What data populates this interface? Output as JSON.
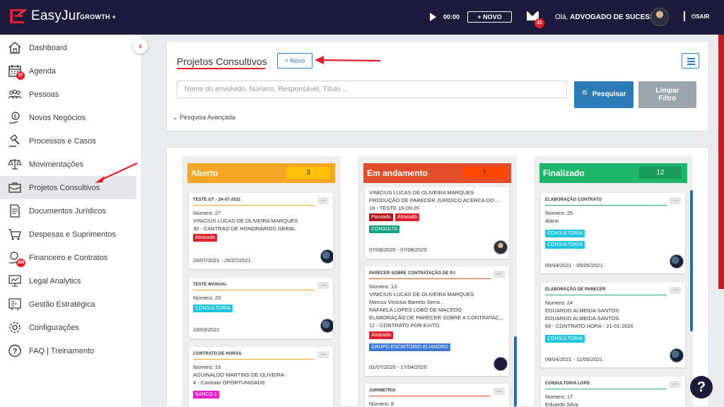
{
  "header": {
    "brand": "EasyJur",
    "plan": "GROWTH +",
    "timer": "00:00",
    "novo_label": "+ NOVO",
    "mail_count": "31",
    "greeting": "Olá,",
    "user": "ADVOGADO DE SUCESSO",
    "logout": "SAIR"
  },
  "sidebar": {
    "items": [
      {
        "label": "Dashboard"
      },
      {
        "label": "Agenda",
        "badge": "37"
      },
      {
        "label": "Pessoas"
      },
      {
        "label": "Novos Negócios"
      },
      {
        "label": "Processos e Casos"
      },
      {
        "label": "Movimentações"
      },
      {
        "label": "Projetos Consultivos"
      },
      {
        "label": "Documentos Jurídicos"
      },
      {
        "label": "Despesas e Suprimentos"
      },
      {
        "label": "Financeiro e Contratos",
        "badge": "290"
      },
      {
        "label": "Legal Analytics"
      },
      {
        "label": "Gestão Estratégica"
      },
      {
        "label": "Configurações"
      },
      {
        "label": "FAQ | Treinamento"
      }
    ]
  },
  "page": {
    "title": "Projetos Consultivos",
    "novo": "+ Novo",
    "search_placeholder": "Nome do envolvido, Número, Responsável, Título...",
    "search_btn": "Pesquisar",
    "clear_btn_1": "Limpar",
    "clear_btn_2": "Filtro",
    "advanced": "Pesquisa Avançada"
  },
  "columns": [
    {
      "title": "Aberto",
      "count": "3",
      "color": "#f5a623",
      "count_bg": "#ffc107",
      "cards": [
        {
          "title": "TESTE GT - 24-07-2021",
          "lines": [
            "Número: 27",
            "VINICIUS LUCAS DE OLIVEIRA MARQUES",
            "30 - CANTRAO DE HONORÁRIOS GERAL"
          ],
          "tags": [
            "Atrasado"
          ],
          "date": "24/07/2021 - 26/07/2021"
        },
        {
          "title": "TESTE MANUAL",
          "lines": [
            "Número: 23"
          ],
          "tags": [
            "CONSULTORIA"
          ],
          "date": "23/03/2021"
        },
        {
          "title": "CONTRATO DE HORAS",
          "lines": [
            "Número: 19",
            "AGUINALDO MARTINS DE OLIVEIRA",
            "4 - Contrato OPORTUNIDADE"
          ],
          "tags": [
            "BANCO 1"
          ]
        }
      ]
    },
    {
      "title": "Em andamento",
      "count": "7",
      "color": "#e04e2b",
      "count_bg": "#ff4500",
      "cards": [
        {
          "lines": [
            "VINICIUS LUCAS DE OLIVEIRA MARQUES",
            "PRODUÇÃO DE PARECER JURÍDICO ACERCA DO ...",
            "16 - TESTE 16-09-20"
          ],
          "tags": [
            "Pausado",
            "Atrasado",
            "CONSULTA"
          ],
          "date": "07/08/2020 - 07/08/2020"
        },
        {
          "title": "PARECER SOBRE CONTRATAÇÃO DE PJ",
          "lines": [
            "Número: 13",
            "VINICIUS LUCAS DE OLIVEIRA MARQUES",
            "Marcus Vinícius Barreto Serra...",
            "RAFAELA LOPES LOBO DE MACEDO",
            "ELABORAÇÃO DE PARECER SOBRE A CONTRATAÇ...",
            "12 - CONTRATO POR EXITO"
          ],
          "tags": [
            "Atrasado",
            "GRUPO ESCRITORIO ELIANDRO"
          ],
          "date": "01/07/2020 - 17/04/2020"
        },
        {
          "title": "JURIMETRIA",
          "lines": [
            "Número: 8"
          ]
        }
      ]
    },
    {
      "title": "Finalizado",
      "count": "12",
      "color": "#1fb56b",
      "count_bg": "#179c5a",
      "cards": [
        {
          "title": "ELABORAÇÃO CONTRATO",
          "lines": [
            "Número: 25",
            "Alano"
          ],
          "tags": [
            "CONSULTORIA",
            "CONSULTORIA"
          ],
          "date": "09/04/2021 - 05/05/2021"
        },
        {
          "title": "ELABORAÇÃO DE PARECER",
          "lines": [
            "Número: 24",
            "EDUARDO ALMEIDA SANTOS",
            "EDUARDO ALMEIDA SANTOS",
            "69 - CONTRATO HORA - 21-01-2020"
          ],
          "tags": [
            "CONSULTORIA"
          ],
          "date": "09/04/2021 - 11/05/2021"
        },
        {
          "title": "CONSULTORIA LGPD",
          "lines": [
            "Número: 17",
            "Eduardo Silva"
          ]
        }
      ]
    }
  ],
  "avatar_label": "perfil_av",
  "colors": {
    "topbar": "#1d1a3c",
    "accent": "#e0202b",
    "primary": "#2b7cb6",
    "tag_red": "#e0202b",
    "tag_darkred": "#b5121b",
    "tag_teal": "#16a085",
    "tag_cyan": "#1bc4e0",
    "tag_blue": "#3c78d8",
    "tag_magenta": "#e91ec8"
  }
}
